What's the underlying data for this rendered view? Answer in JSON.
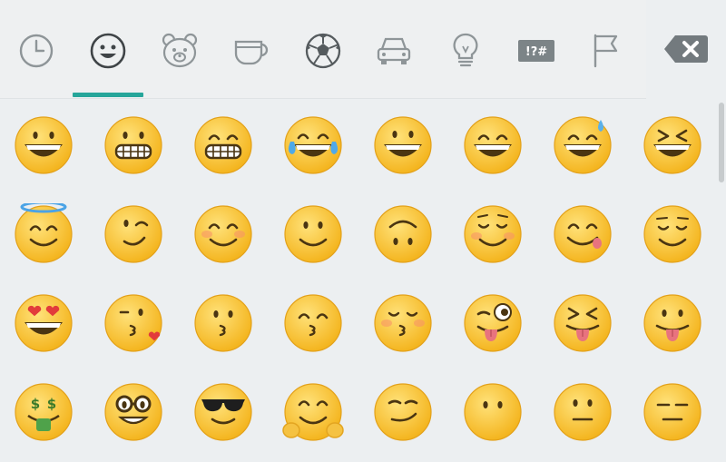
{
  "keyboard": {
    "categories": [
      {
        "icon": "clock-icon",
        "name": "recent",
        "selected": false
      },
      {
        "icon": "smiley-icon",
        "name": "smileys",
        "selected": true
      },
      {
        "icon": "bear-icon",
        "name": "animals",
        "selected": false
      },
      {
        "icon": "cup-icon",
        "name": "food",
        "selected": false
      },
      {
        "icon": "soccer-ball-icon",
        "name": "activity",
        "selected": false
      },
      {
        "icon": "car-icon",
        "name": "travel",
        "selected": false
      },
      {
        "icon": "lightbulb-icon",
        "name": "objects",
        "selected": false
      },
      {
        "icon": "symbols-icon",
        "name": "symbols",
        "selected": false,
        "label": "!?#"
      },
      {
        "icon": "flag-icon",
        "name": "flags",
        "selected": false
      }
    ],
    "accent_color": "#26a69a",
    "backspace_icon": "backspace-icon",
    "emoji_rows": [
      [
        "grinning-face",
        "grimacing-face",
        "grimacing-face-alt",
        "face-with-tears-of-joy",
        "smiling-face-open-mouth",
        "smiling-face-smiling-eyes",
        "smiling-face-cold-sweat",
        "squinting-face"
      ],
      [
        "smiling-face-halo",
        "winking-face",
        "smiling-face-blush",
        "slightly-smiling-face",
        "upside-down-face",
        "relieved-blush-face",
        "face-savoring-food",
        "relieved-face"
      ],
      [
        "heart-eyes-face",
        "face-blowing-kiss",
        "kissing-face",
        "kissing-smiling-eyes",
        "kissing-closed-eyes",
        "zany-face",
        "squinting-face-tongue",
        "face-with-tongue"
      ],
      [
        "money-mouth-face",
        "nerd-face",
        "sunglasses-face",
        "hugging-face",
        "smirking-face",
        "face-without-mouth",
        "neutral-face",
        "expressionless-face"
      ]
    ]
  }
}
